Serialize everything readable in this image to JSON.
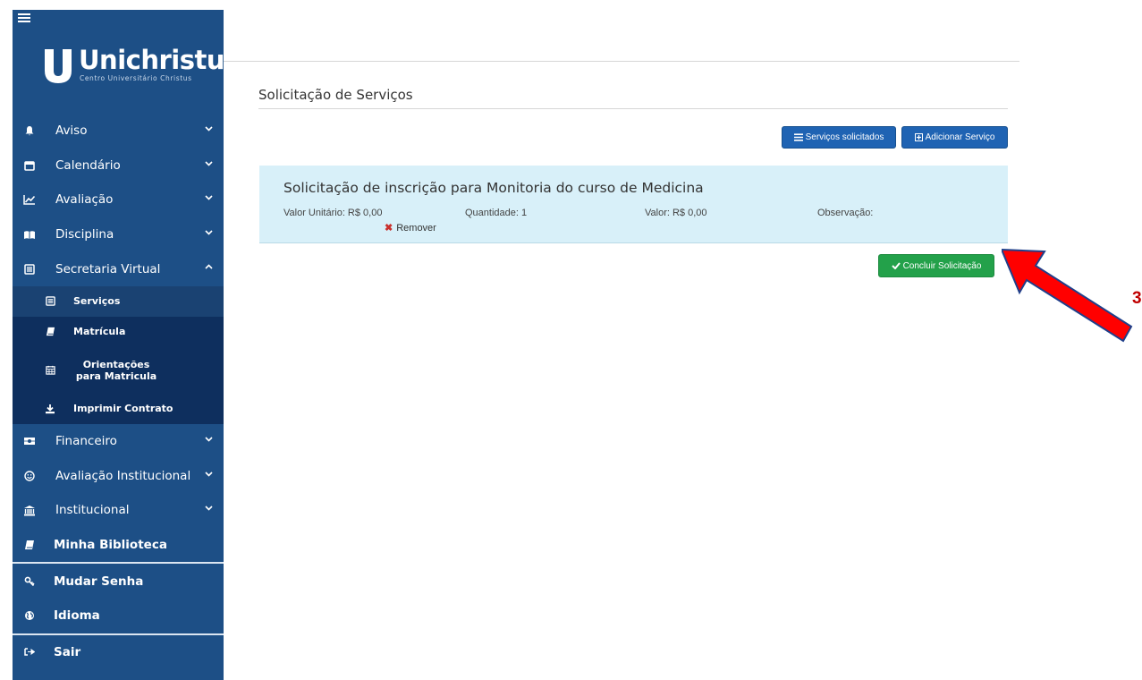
{
  "sidebar": {
    "logo": {
      "name": "Unichristus",
      "subtitle": "Centro Universitário Christus"
    },
    "menu": [
      {
        "label": "Aviso",
        "icon": "bell-icon"
      },
      {
        "label": "Calendário",
        "icon": "calendar-icon"
      },
      {
        "label": "Avaliação",
        "icon": "line-chart-icon"
      },
      {
        "label": "Disciplina",
        "icon": "open-book-icon"
      },
      {
        "label": "Secretaria Virtual",
        "icon": "newspaper-icon"
      }
    ],
    "submenu": [
      {
        "label": "Serviços",
        "icon": "newspaper-icon"
      },
      {
        "label": "Matrícula",
        "icon": "book-icon"
      },
      {
        "label": "Orientações para Matricula",
        "icon": "calendar-grid-icon"
      },
      {
        "label": "Imprimir Contrato",
        "icon": "download-icon"
      }
    ],
    "menu2": [
      {
        "label": "Financeiro",
        "icon": "money-icon"
      },
      {
        "label": "Avaliação Institucional",
        "icon": "smile-icon"
      },
      {
        "label": "Institucional",
        "icon": "institution-icon"
      },
      {
        "label": "Minha Biblioteca",
        "icon": "book-icon"
      }
    ],
    "account": [
      {
        "label": "Mudar Senha",
        "icon": "key-icon"
      },
      {
        "label": "Idioma",
        "icon": "globe-icon"
      }
    ],
    "logout": {
      "label": "Sair",
      "icon": "sign-out-icon"
    }
  },
  "main": {
    "page_title": "Solicitação de Serviços",
    "buttons": {
      "requested": "Serviços solicitados",
      "add": "Adicionar Serviço",
      "conclude": "Concluir Solicitação"
    },
    "service": {
      "title": "Solicitação de inscrição para Monitoria do curso de Medicina",
      "unit_value": "Valor Unitário: R$ 0,00",
      "quantity": "Quantidade: 1",
      "value": "Valor: R$ 0,00",
      "observation": "Observação:",
      "remove": "Remover"
    }
  },
  "annotation": {
    "step": "3",
    "color": "#ff0000"
  }
}
